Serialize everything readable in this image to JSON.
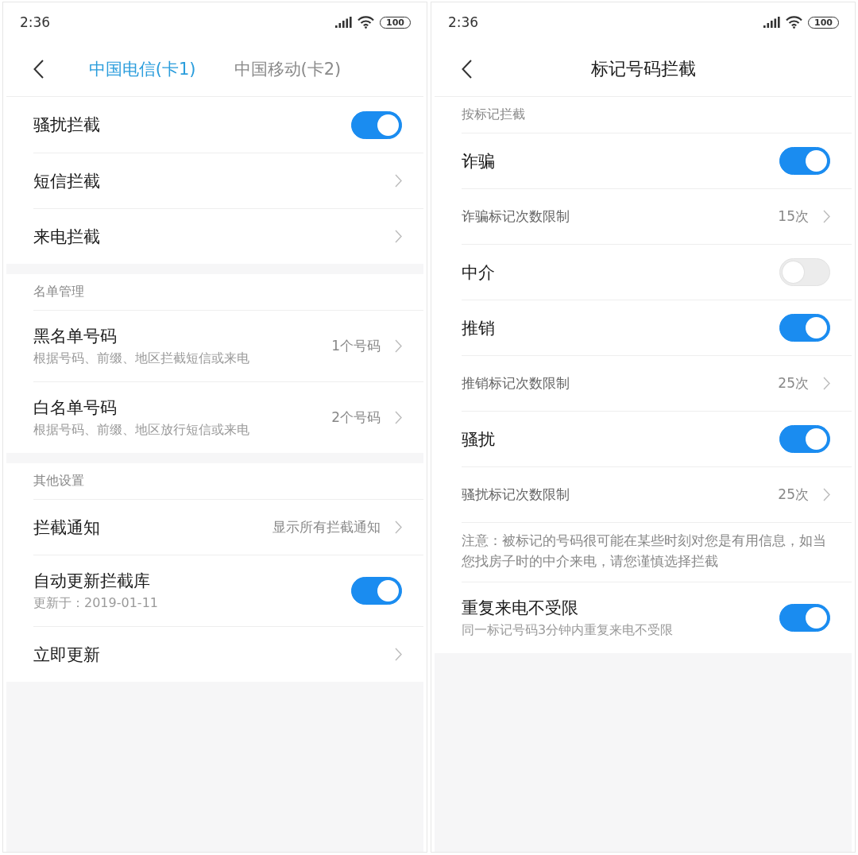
{
  "screens": [
    {
      "status_bar": {
        "time": "2:36",
        "battery": "100"
      },
      "header": {
        "kind": "tabs",
        "tabs": [
          {
            "label": "中国电信(卡1)",
            "selected": true
          },
          {
            "label": "中国移动(卡2)",
            "selected": false
          }
        ]
      },
      "sections": [
        {
          "rows": [
            {
              "kind": "toggle",
              "label": "骚扰拦截",
              "on": true
            },
            {
              "kind": "link",
              "label": "短信拦截"
            },
            {
              "kind": "link",
              "label": "来电拦截"
            }
          ]
        },
        {
          "title": "名单管理",
          "rows": [
            {
              "kind": "link",
              "label": "黑名单号码",
              "subtitle": "根据号码、前缀、地区拦截短信或来电",
              "value": "1个号码"
            },
            {
              "kind": "link",
              "label": "白名单号码",
              "subtitle": "根据号码、前缀、地区放行短信或来电",
              "value": "2个号码"
            }
          ]
        },
        {
          "title": "其他设置",
          "rows": [
            {
              "kind": "link",
              "label": "拦截通知",
              "value": "显示所有拦截通知"
            },
            {
              "kind": "toggle",
              "label": "自动更新拦截库",
              "subtitle": "更新于：2019-01-11",
              "on": true
            },
            {
              "kind": "link",
              "label": "立即更新"
            }
          ]
        }
      ]
    },
    {
      "status_bar": {
        "time": "2:36",
        "battery": "100"
      },
      "header": {
        "kind": "title",
        "title": "标记号码拦截"
      },
      "sections": [
        {
          "title": "按标记拦截",
          "rows": [
            {
              "kind": "toggle",
              "label": "诈骗",
              "on": true
            },
            {
              "kind": "limit",
              "label": "诈骗标记次数限制",
              "value": "15次"
            },
            {
              "kind": "toggle",
              "label": "中介",
              "on": false
            },
            {
              "kind": "toggle",
              "label": "推销",
              "on": true
            },
            {
              "kind": "limit",
              "label": "推销标记次数限制",
              "value": "25次"
            },
            {
              "kind": "toggle",
              "label": "骚扰",
              "on": true
            },
            {
              "kind": "limit",
              "label": "骚扰标记次数限制",
              "value": "25次"
            },
            {
              "kind": "note",
              "text": "注意：被标记的号码很可能在某些时刻对您是有用信息，如当您找房子时的中介来电，请您谨慎选择拦截"
            },
            {
              "kind": "toggle",
              "label": "重复来电不受限",
              "subtitle": "同一标记号码3分钟内重复来电不受限",
              "on": true
            }
          ]
        }
      ]
    }
  ]
}
